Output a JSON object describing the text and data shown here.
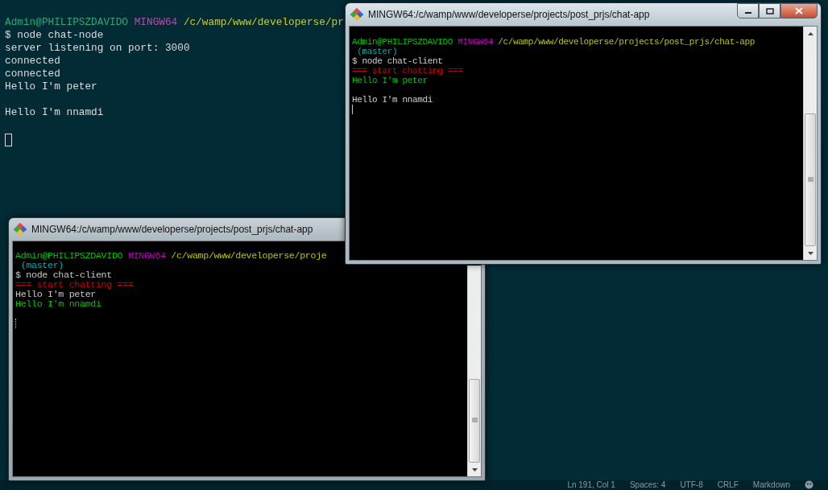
{
  "background_terminal": {
    "lines": [
      {
        "kind": "text",
        "segments": [
          {
            "text": "Admin@PHILIPSZDAVIDO ",
            "color": "#2aa876"
          },
          {
            "text": "MINGW64 ",
            "color": "#b44bb0"
          },
          {
            "text": "/c/wamp/www/developerse/pr",
            "color": "#cfcf1a"
          }
        ]
      },
      {
        "kind": "text",
        "segments": [
          {
            "text": "$ node chat-node",
            "color": "#dcdcdc"
          }
        ]
      },
      {
        "kind": "text",
        "segments": [
          {
            "text": "server listening on port: 3000",
            "color": "#dcdcdc"
          }
        ]
      },
      {
        "kind": "text",
        "segments": [
          {
            "text": "connected",
            "color": "#dcdcdc"
          }
        ]
      },
      {
        "kind": "text",
        "segments": [
          {
            "text": "connected",
            "color": "#dcdcdc"
          }
        ]
      },
      {
        "kind": "text",
        "segments": [
          {
            "text": "Hello I'm peter",
            "color": "#dcdcdc"
          }
        ]
      },
      {
        "kind": "blank"
      },
      {
        "kind": "text",
        "segments": [
          {
            "text": "Hello I'm nnamdi",
            "color": "#dcdcdc"
          }
        ]
      },
      {
        "kind": "blank"
      },
      {
        "kind": "cursor"
      }
    ]
  },
  "windows": [
    {
      "title": "MINGW64:/c/wamp/www/developerse/projects/post_prjs/chat-app",
      "active": false,
      "lines": [
        {
          "kind": "text",
          "segments": [
            {
              "text": "Admin@PHILIPSZDAVIDO ",
              "color": "#00c000"
            },
            {
              "text": "MINGW64 ",
              "color": "#c000c0"
            },
            {
              "text": "/c/wamp/www/developerse/proje",
              "color": "#c0c000"
            }
          ]
        },
        {
          "kind": "text",
          "segments": [
            {
              "text": " (master)",
              "color": "#00aaaa"
            }
          ]
        },
        {
          "kind": "text",
          "segments": [
            {
              "text": "$ node chat-client",
              "color": "#c8c8c8"
            }
          ]
        },
        {
          "kind": "text",
          "segments": [
            {
              "text": "=== start chatting ===",
              "color": "#cc0000"
            }
          ]
        },
        {
          "kind": "text",
          "segments": [
            {
              "text": "Hello I'm peter",
              "color": "#c8c8c8"
            }
          ]
        },
        {
          "kind": "text",
          "segments": [
            {
              "text": "Hello I'm nnamdi",
              "color": "#00c000"
            }
          ]
        },
        {
          "kind": "blank"
        },
        {
          "kind": "cursor"
        }
      ]
    },
    {
      "title": "MINGW64:/c/wamp/www/developerse/projects/post_prjs/chat-app",
      "active": true,
      "lines": [
        {
          "kind": "text",
          "segments": [
            {
              "text": "Admin@PHILIPSZDAVIDO ",
              "color": "#00c000"
            },
            {
              "text": "MINGW64 ",
              "color": "#c000c0"
            },
            {
              "text": "/c/wamp/www/developerse/projects/post_prjs/chat-app",
              "color": "#c0c000"
            }
          ]
        },
        {
          "kind": "text",
          "segments": [
            {
              "text": " (master)",
              "color": "#00aaaa"
            }
          ]
        },
        {
          "kind": "text",
          "segments": [
            {
              "text": "$ node chat-client",
              "color": "#d0d0d0"
            }
          ]
        },
        {
          "kind": "text",
          "segments": [
            {
              "text": "=== start chatting ===",
              "color": "#cc0000"
            }
          ]
        },
        {
          "kind": "text",
          "segments": [
            {
              "text": "Hello I'm peter",
              "color": "#00c000"
            }
          ]
        },
        {
          "kind": "blank"
        },
        {
          "kind": "text",
          "segments": [
            {
              "text": "Hello I'm nnamdi",
              "color": "#d0d0d0"
            }
          ]
        },
        {
          "kind": "cursor"
        }
      ]
    }
  ],
  "status_bar": [
    "Ln 191, Col 1",
    "Spaces: 4",
    "UTF-8",
    "CRLF",
    "Markdown"
  ]
}
